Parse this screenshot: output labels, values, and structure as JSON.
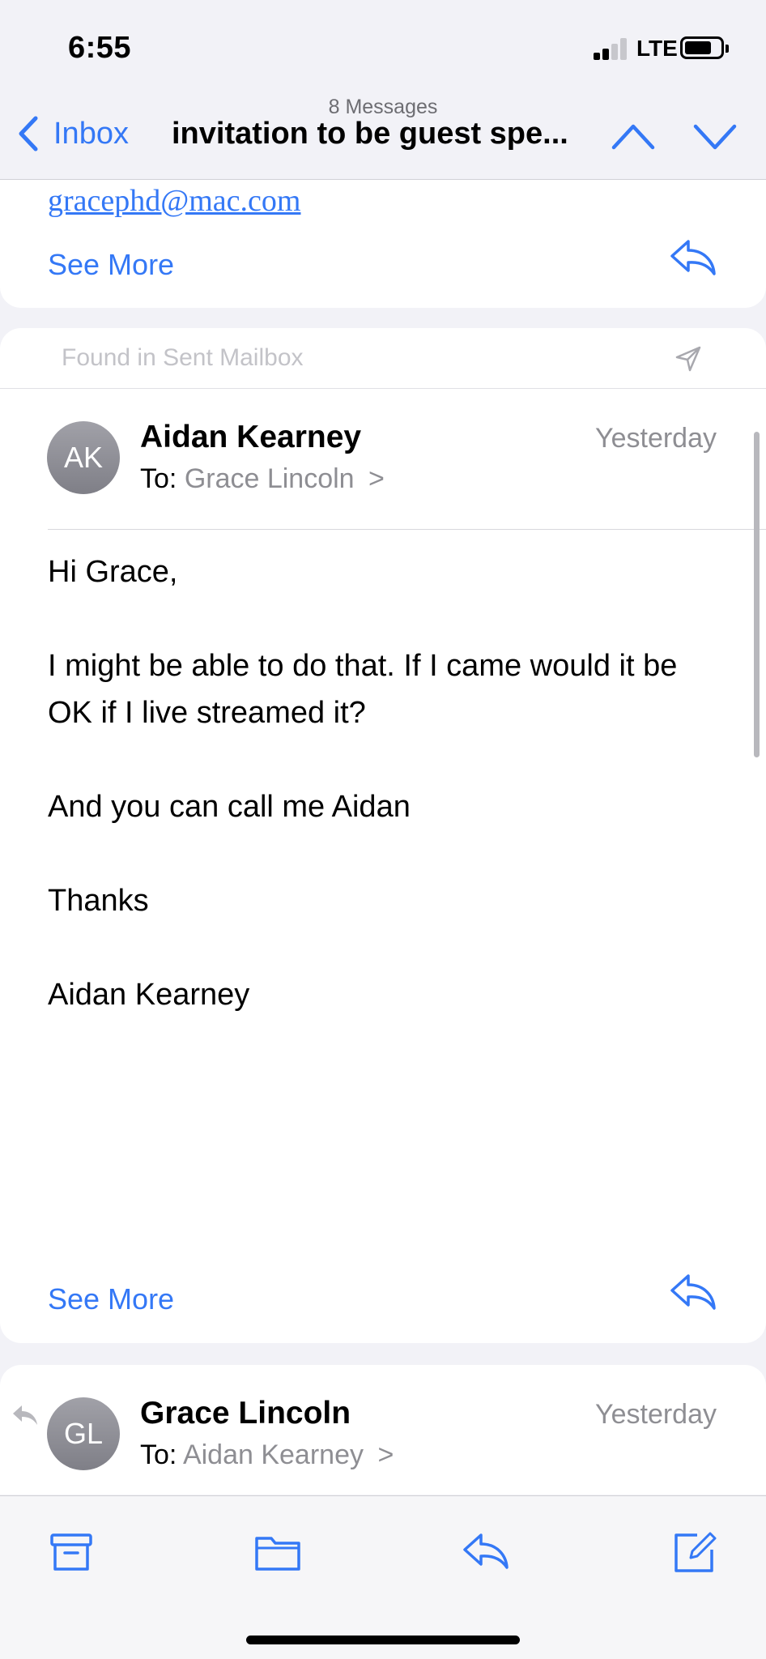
{
  "status_bar": {
    "time": "6:55",
    "network": "LTE"
  },
  "nav": {
    "message_count": "8 Messages",
    "back_label": "Inbox",
    "subject": "invitation to be guest spe..."
  },
  "prev_message": {
    "email": "gracephd@mac.com",
    "see_more": "See More"
  },
  "current_message": {
    "found_label": "Found in Sent Mailbox",
    "avatar_initials": "AK",
    "sender": "Aidan Kearney",
    "date": "Yesterday",
    "to_prefix": "To:",
    "to_name": "Grace Lincoln",
    "chevron": ">",
    "body": [
      "Hi Grace,",
      "",
      "I might be able to do that. If I came would it be OK if I live streamed it?",
      "",
      "And you can call me Aidan",
      "",
      "Thanks",
      "",
      "Aidan Kearney"
    ],
    "see_more": "See More"
  },
  "next_message": {
    "avatar_initials": "GL",
    "sender": "Grace Lincoln",
    "date": "Yesterday",
    "to_prefix": "To:",
    "to_name": "Aidan Kearney",
    "chevron": ">"
  },
  "colors": {
    "accent": "#3478f6",
    "secondary_text": "#8e8e93",
    "background": "#f2f2f7"
  },
  "toolbar_icons": [
    "archive-icon",
    "folder-icon",
    "reply-icon",
    "compose-icon"
  ]
}
